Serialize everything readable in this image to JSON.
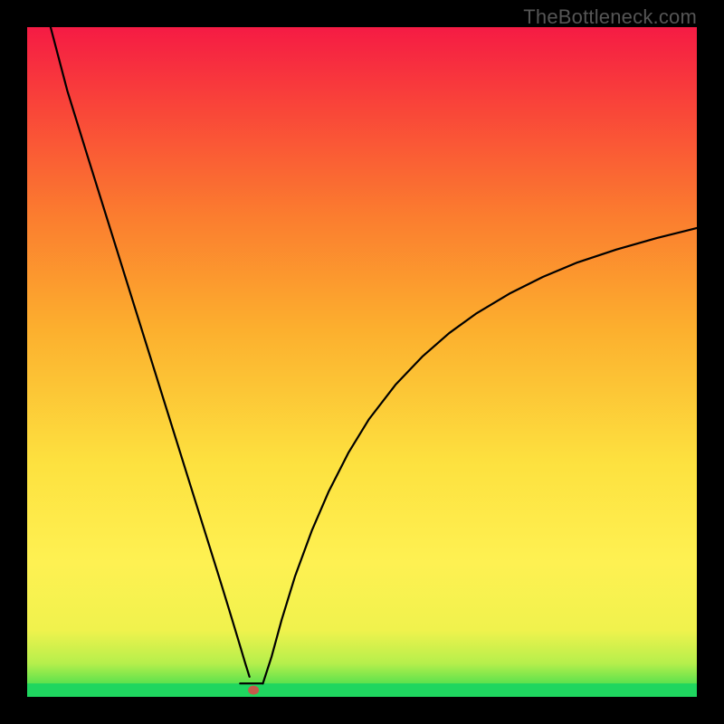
{
  "watermark": "TheBottleneck.com",
  "chart_data": {
    "type": "line",
    "title": "",
    "xlabel": "",
    "ylabel": "",
    "xlim": [
      0,
      100
    ],
    "ylim": [
      0,
      100
    ],
    "gradient_stops": [
      {
        "offset": 0.0,
        "color": "#1fd65f"
      },
      {
        "offset": 0.02,
        "color": "#5de24d"
      },
      {
        "offset": 0.05,
        "color": "#b6ef4c"
      },
      {
        "offset": 0.1,
        "color": "#f0f24d"
      },
      {
        "offset": 0.2,
        "color": "#fef152"
      },
      {
        "offset": 0.35,
        "color": "#fde13f"
      },
      {
        "offset": 0.55,
        "color": "#fcaf2e"
      },
      {
        "offset": 0.72,
        "color": "#fb7c2f"
      },
      {
        "offset": 0.88,
        "color": "#f94539"
      },
      {
        "offset": 1.0,
        "color": "#f51b44"
      }
    ],
    "green_band": {
      "y_bottom": 0,
      "y_top": 2,
      "color": "#1fd65f"
    },
    "marker": {
      "x": 33.8,
      "y": 1.0,
      "color": "#c45a4a",
      "rx": 6,
      "ry": 5
    },
    "series": [
      {
        "name": "left-branch",
        "x": [
          3.5,
          6,
          9,
          12,
          15,
          18,
          21,
          24,
          27,
          29,
          30.5,
          31.8,
          32.6,
          33.2
        ],
        "y": [
          100,
          90.5,
          80.8,
          71.2,
          61.6,
          52.0,
          42.4,
          32.8,
          23.2,
          16.8,
          11.9,
          7.6,
          4.9,
          3.0
        ]
      },
      {
        "name": "flat-notch",
        "x": [
          31.8,
          35.2
        ],
        "y": [
          2.0,
          2.0
        ]
      },
      {
        "name": "right-branch",
        "x": [
          35.2,
          36.5,
          38,
          40,
          42.5,
          45,
          48,
          51,
          55,
          59,
          63,
          67,
          72,
          77,
          82,
          88,
          94,
          100
        ],
        "y": [
          2.0,
          6.0,
          11.5,
          18.0,
          24.8,
          30.6,
          36.5,
          41.4,
          46.6,
          50.8,
          54.3,
          57.2,
          60.2,
          62.7,
          64.8,
          66.8,
          68.5,
          70.0
        ]
      }
    ]
  }
}
